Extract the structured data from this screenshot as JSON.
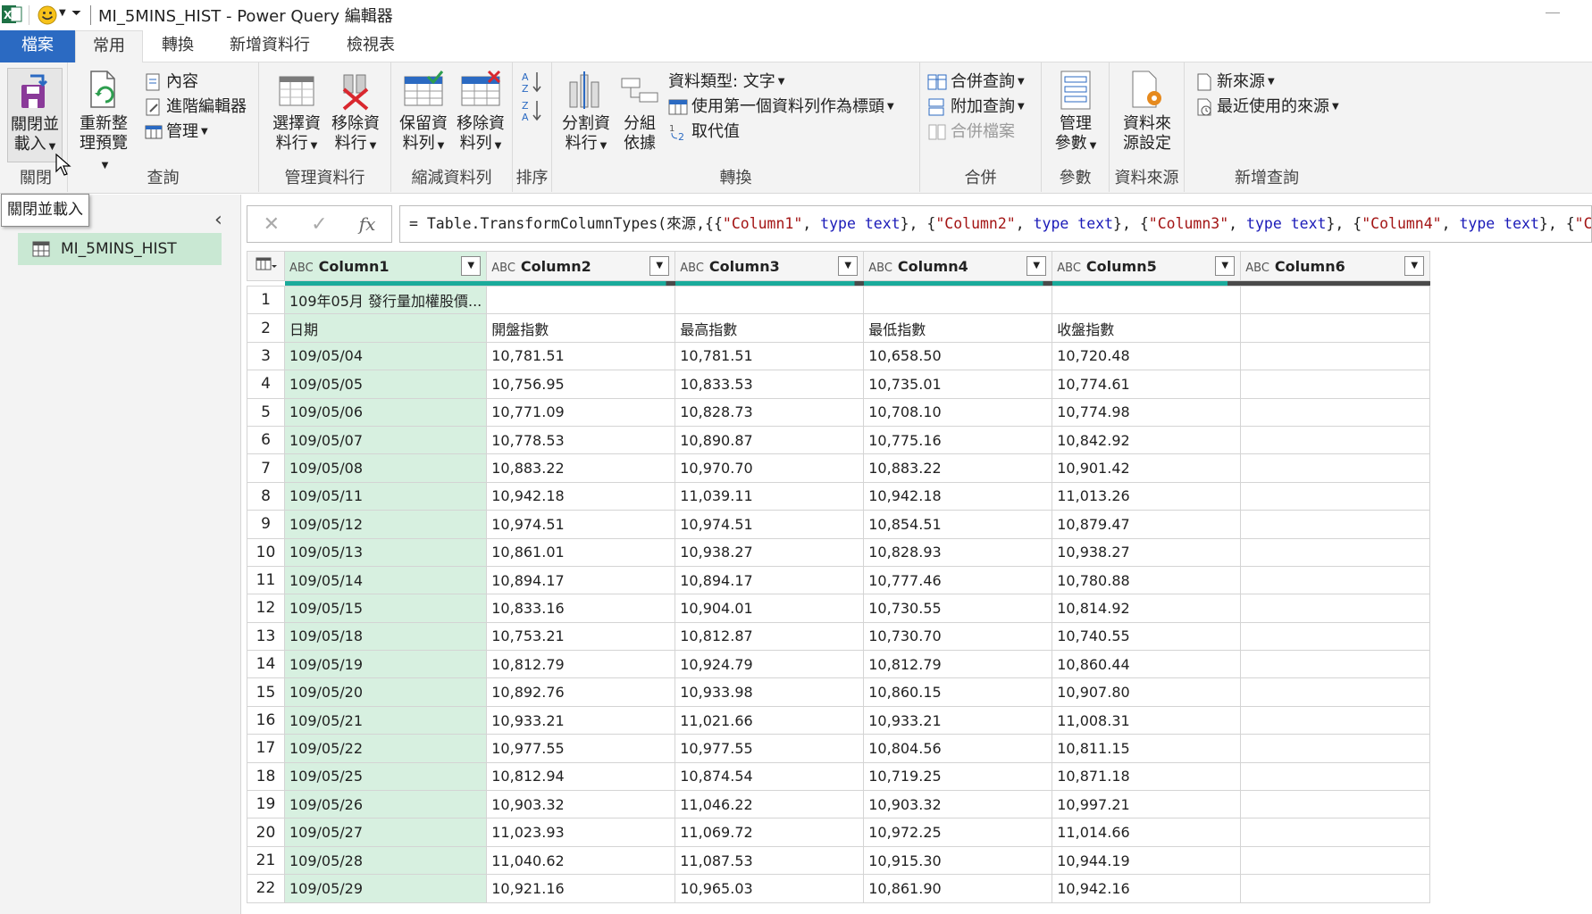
{
  "titlebar": {
    "title": "MI_5MINS_HIST - Power Query 編輯器"
  },
  "tabs": [
    "檔案",
    "常用",
    "轉換",
    "新增資料行",
    "檢視表"
  ],
  "ribbon": {
    "close": {
      "btn_line1": "關閉並",
      "btn_line2": "載入",
      "label": "關閉"
    },
    "query": {
      "refresh_line1": "重新整",
      "refresh_line2": "理預覽",
      "properties": "內容",
      "advanced_editor": "進階編輯器",
      "manage": "管理",
      "label": "查詢"
    },
    "manage_cols": {
      "choose_line1": "選擇資",
      "choose_line2": "料行",
      "remove_line1": "移除資",
      "remove_line2": "料行",
      "label": "管理資料行"
    },
    "reduce_rows": {
      "keep_line1": "保留資",
      "keep_line2": "料列",
      "remove_line1": "移除資",
      "remove_line2": "料列",
      "label": "縮減資料列"
    },
    "sort": {
      "label": "排序"
    },
    "transform": {
      "split_line1": "分割資",
      "split_line2": "料行",
      "group_line1": "分組",
      "group_line2": "依據",
      "data_type": "資料類型: 文字",
      "first_row_header": "使用第一個資料列作為標頭",
      "replace_values": "取代值",
      "label": "轉換"
    },
    "combine": {
      "merge": "合併查詢",
      "append": "附加查詢",
      "combine_files": "合併檔案",
      "label": "合併"
    },
    "params": {
      "line1": "管理",
      "line2": "參數",
      "label": "參數"
    },
    "datasource": {
      "line1": "資料來",
      "line2": "源設定",
      "label": "資料來源"
    },
    "newquery": {
      "new_source": "新來源",
      "recent": "最近使用的來源",
      "label": "新增查詢"
    }
  },
  "tooltip": "關閉並載入",
  "leftpane": {
    "query_name": "MI_5MINS_HIST"
  },
  "formula": {
    "prefix": "= Table.TransformColumnTypes(來源,{{",
    "parts": [
      {
        "col": "\"Column1\"",
        "type": "type",
        "t": "text"
      },
      {
        "col": "\"Column2\"",
        "type": "type",
        "t": "text"
      },
      {
        "col": "\"Column3\"",
        "type": "type",
        "t": "text"
      },
      {
        "col": "\"Column4\"",
        "type": "type",
        "t": "text"
      }
    ],
    "tail": "\"C"
  },
  "table": {
    "columns": [
      "Column1",
      "Column2",
      "Column3",
      "Column4",
      "Column5",
      "Column6"
    ],
    "type_icon": "ABC",
    "rows": [
      [
        "1",
        "109年05月 發行量加權股價...",
        "",
        "",
        "",
        "",
        ""
      ],
      [
        "2",
        "日期",
        "開盤指數",
        "最高指數",
        "最低指數",
        "收盤指數",
        ""
      ],
      [
        "3",
        "109/05/04",
        "10,781.51",
        "10,781.51",
        "10,658.50",
        "10,720.48",
        ""
      ],
      [
        "4",
        "109/05/05",
        "10,756.95",
        "10,833.53",
        "10,735.01",
        "10,774.61",
        ""
      ],
      [
        "5",
        "109/05/06",
        "10,771.09",
        "10,828.73",
        "10,708.10",
        "10,774.98",
        ""
      ],
      [
        "6",
        "109/05/07",
        "10,778.53",
        "10,890.87",
        "10,775.16",
        "10,842.92",
        ""
      ],
      [
        "7",
        "109/05/08",
        "10,883.22",
        "10,970.70",
        "10,883.22",
        "10,901.42",
        ""
      ],
      [
        "8",
        "109/05/11",
        "10,942.18",
        "11,039.11",
        "10,942.18",
        "11,013.26",
        ""
      ],
      [
        "9",
        "109/05/12",
        "10,974.51",
        "10,974.51",
        "10,854.51",
        "10,879.47",
        ""
      ],
      [
        "10",
        "109/05/13",
        "10,861.01",
        "10,938.27",
        "10,828.93",
        "10,938.27",
        ""
      ],
      [
        "11",
        "109/05/14",
        "10,894.17",
        "10,894.17",
        "10,777.46",
        "10,780.88",
        ""
      ],
      [
        "12",
        "109/05/15",
        "10,833.16",
        "10,904.01",
        "10,730.55",
        "10,814.92",
        ""
      ],
      [
        "13",
        "109/05/18",
        "10,753.21",
        "10,812.87",
        "10,730.70",
        "10,740.55",
        ""
      ],
      [
        "14",
        "109/05/19",
        "10,812.79",
        "10,924.79",
        "10,812.79",
        "10,860.44",
        ""
      ],
      [
        "15",
        "109/05/20",
        "10,892.76",
        "10,933.98",
        "10,860.15",
        "10,907.80",
        ""
      ],
      [
        "16",
        "109/05/21",
        "10,933.21",
        "11,021.66",
        "10,933.21",
        "11,008.31",
        ""
      ],
      [
        "17",
        "109/05/22",
        "10,977.55",
        "10,977.55",
        "10,804.56",
        "10,811.15",
        ""
      ],
      [
        "18",
        "109/05/25",
        "10,812.94",
        "10,874.54",
        "10,719.25",
        "10,871.18",
        ""
      ],
      [
        "19",
        "109/05/26",
        "10,903.32",
        "11,046.22",
        "10,903.32",
        "10,997.21",
        ""
      ],
      [
        "20",
        "109/05/27",
        "11,023.93",
        "11,069.72",
        "10,972.25",
        "11,014.66",
        ""
      ],
      [
        "21",
        "109/05/28",
        "11,040.62",
        "11,087.53",
        "10,915.30",
        "10,944.19",
        ""
      ],
      [
        "22",
        "109/05/29",
        "10,921.16",
        "10,965.03",
        "10,861.90",
        "10,942.16",
        ""
      ]
    ]
  },
  "colors": {
    "accent": "#2b6ac2",
    "selected_col": "#d7f0e0",
    "quality_ok": "#1aab9b",
    "quality_empty": "#4a4a4a"
  }
}
